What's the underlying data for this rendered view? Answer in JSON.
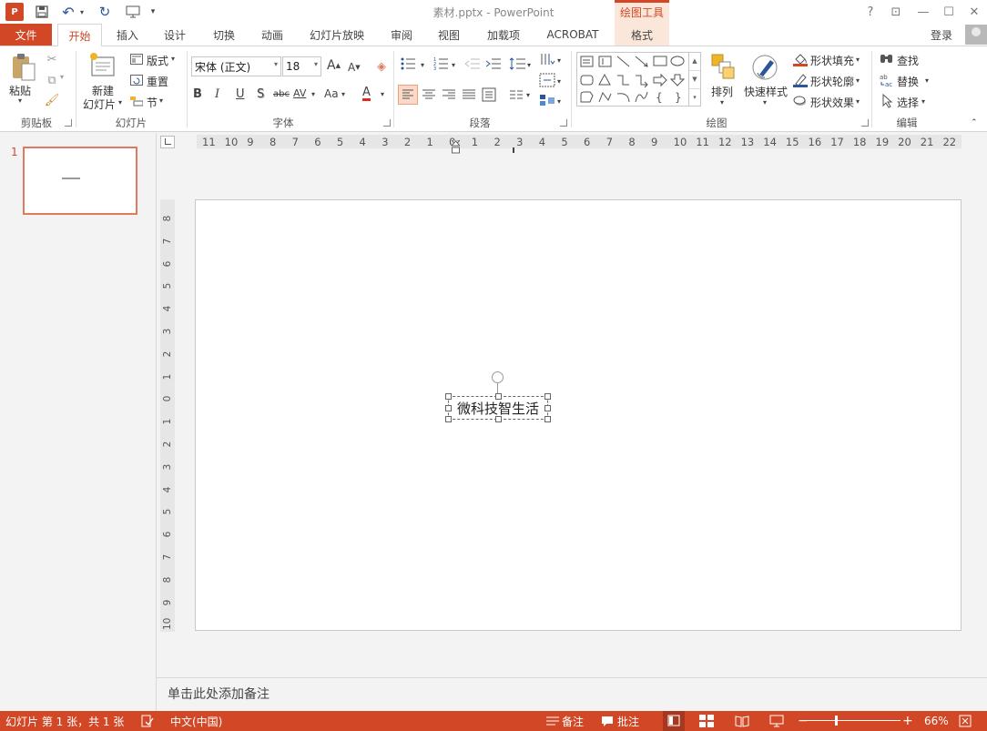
{
  "window": {
    "title": "素材.pptx - PowerPoint",
    "context_tool_label": "绘图工具",
    "help": "?",
    "controls": [
      "⊡",
      "—",
      "☐",
      "✕"
    ]
  },
  "qat": {
    "app_icon": "P",
    "save": "💾",
    "undo": "↶",
    "redo": "↻",
    "present": "▣",
    "more": "▾"
  },
  "tabs": {
    "file": "文件",
    "home": "开始",
    "insert": "插入",
    "design": "设计",
    "transitions": "切换",
    "animations": "动画",
    "slideshow": "幻灯片放映",
    "review": "审阅",
    "view": "视图",
    "addins": "加载项",
    "acrobat": "ACROBAT",
    "format": "格式"
  },
  "account": {
    "login": "登录"
  },
  "ribbon": {
    "clipboard": {
      "paste": "粘贴",
      "group": "剪贴板"
    },
    "slides": {
      "new_slide_1": "新建",
      "new_slide_2": "幻灯片",
      "layout": "版式",
      "reset": "重置",
      "section": "节",
      "group": "幻灯片"
    },
    "font": {
      "name": "宋体 (正文)",
      "size": "18",
      "grow": "A",
      "shrink": "A",
      "bold": "B",
      "italic": "I",
      "underline": "U",
      "shadow": "S",
      "strike": "abc",
      "spacing": "AV",
      "case": "Aa",
      "color": "A",
      "group": "字体"
    },
    "paragraph": {
      "group": "段落"
    },
    "drawing": {
      "arrange": "排列",
      "quick_styles": "快速样式",
      "fill": "形状填充",
      "outline": "形状轮廓",
      "effects": "形状效果",
      "group": "绘图"
    },
    "editing": {
      "find": "查找",
      "replace": "替换",
      "select": "选择",
      "group": "编辑"
    }
  },
  "ruler": {
    "h_ticks": [
      "11",
      "10",
      "9",
      "8",
      "7",
      "6",
      "5",
      "4",
      "3",
      "2",
      "1",
      "0",
      "1",
      "2",
      "3",
      "4",
      "5",
      "6",
      "7",
      "8",
      "9",
      "10",
      "11",
      "12",
      "13",
      "14",
      "15",
      "16",
      "17",
      "18",
      "19",
      "20",
      "21",
      "22"
    ],
    "v_ticks": [
      "8",
      "7",
      "6",
      "5",
      "4",
      "3",
      "2",
      "1",
      "0",
      "1",
      "2",
      "3",
      "4",
      "5",
      "6",
      "7",
      "8",
      "9",
      "10"
    ]
  },
  "slides_pane": {
    "slide_number": "1"
  },
  "slide": {
    "textbox_text": "微科技智生活"
  },
  "notes": {
    "placeholder": "单击此处添加备注"
  },
  "statusbar": {
    "slide_info": "幻灯片 第 1 张，共 1 张",
    "language": "中文(中国)",
    "notes": "备注",
    "comments": "批注",
    "zoom_minus": "−",
    "zoom_plus": "+",
    "zoom": "66%"
  }
}
